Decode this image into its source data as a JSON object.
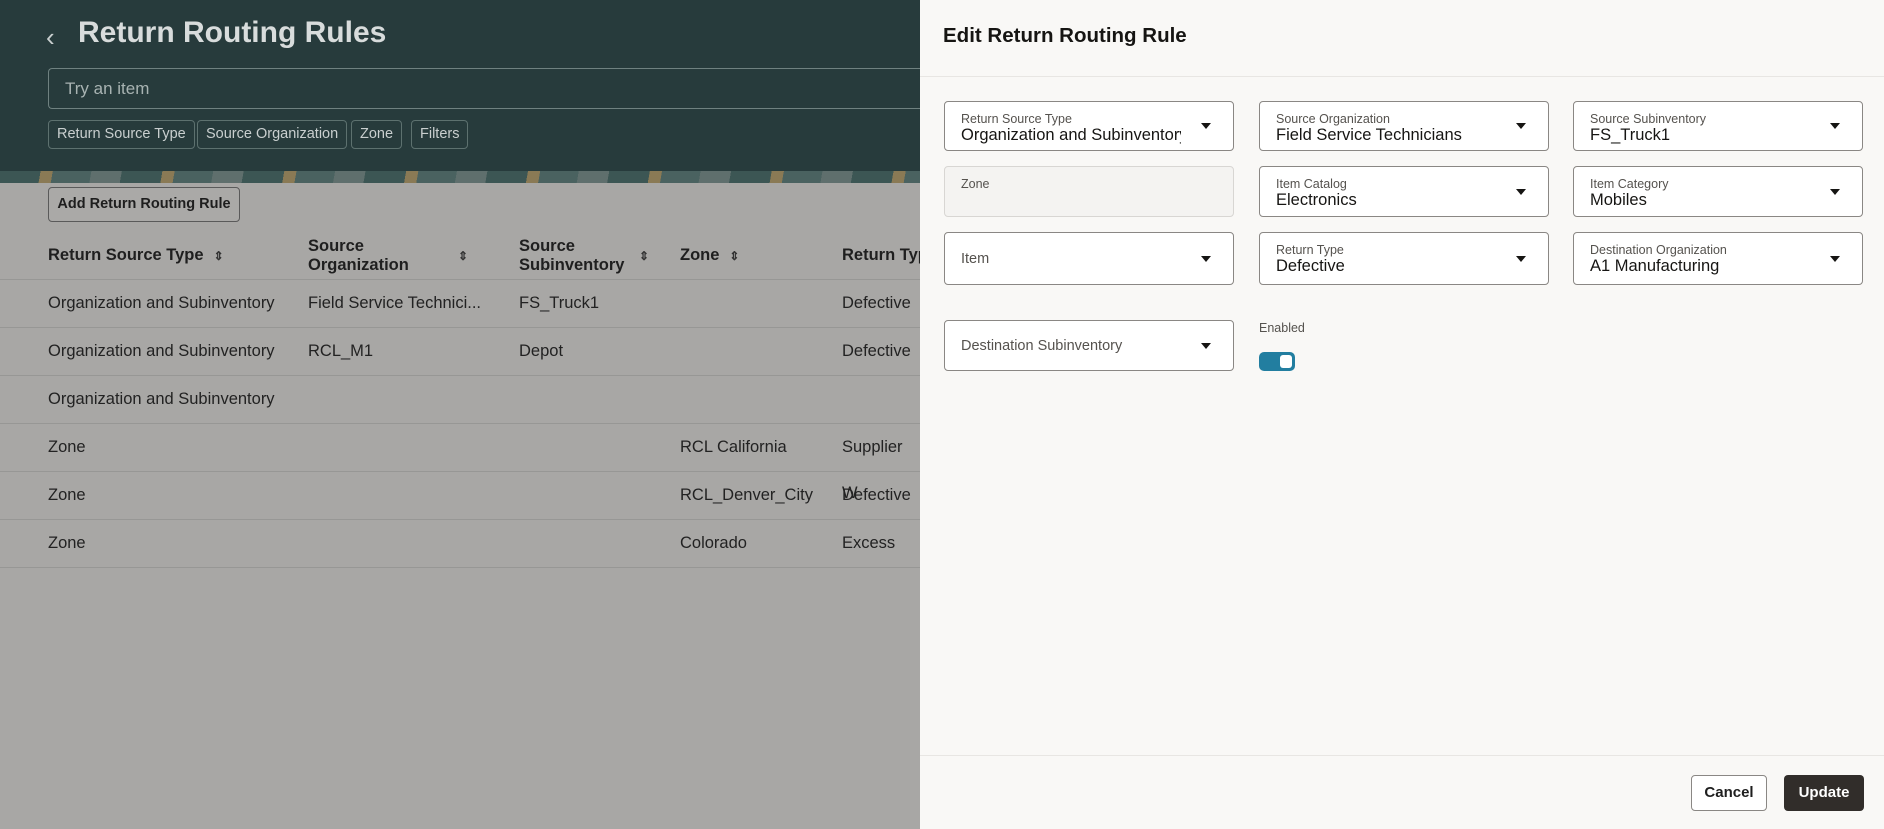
{
  "page": {
    "title": "Return Routing Rules",
    "search_placeholder": "Try an item",
    "filters": [
      "Return Source Type",
      "Source Organization",
      "Zone",
      "Filters"
    ],
    "add_button": "Add Return Routing Rule",
    "columns": [
      "Return Source Type",
      "Source Organization",
      "Source Subinventory",
      "Zone",
      "Return Typ"
    ],
    "rows": [
      [
        "Organization and Subinventory",
        "Field Service Technici...",
        "FS_Truck1",
        "",
        "Defective"
      ],
      [
        "Organization and Subinventory",
        "RCL_M1",
        "Depot",
        "",
        "Defective"
      ],
      [
        "Organization and Subinventory",
        "",
        "",
        "",
        ""
      ],
      [
        "Zone",
        "",
        "",
        "RCL California",
        "Supplier W"
      ],
      [
        "Zone",
        "",
        "",
        "RCL_Denver_City",
        "Defective"
      ],
      [
        "Zone",
        "",
        "",
        "Colorado",
        "Excess"
      ]
    ]
  },
  "panel": {
    "title": "Edit Return Routing Rule",
    "fields": [
      {
        "label": "Return Source Type",
        "value": "Organization and Subinventory"
      },
      {
        "label": "Source Organization",
        "value": "Field Service Technicians"
      },
      {
        "label": "Source Subinventory",
        "value": "FS_Truck1"
      },
      {
        "label": "Zone",
        "value": ""
      },
      {
        "label": "Item Catalog",
        "value": "Electronics"
      },
      {
        "label": "Item Category",
        "value": "Mobiles"
      },
      {
        "label": "Item",
        "value": ""
      },
      {
        "label": "Return Type",
        "value": "Defective"
      },
      {
        "label": "Destination Organization",
        "value": "A1 Manufacturing"
      },
      {
        "label": "Destination Subinventory",
        "value": ""
      }
    ],
    "enabled_label": "Enabled",
    "enabled": true,
    "toggle_color": "#227ea0",
    "cancel": "Cancel",
    "update": "Update"
  }
}
